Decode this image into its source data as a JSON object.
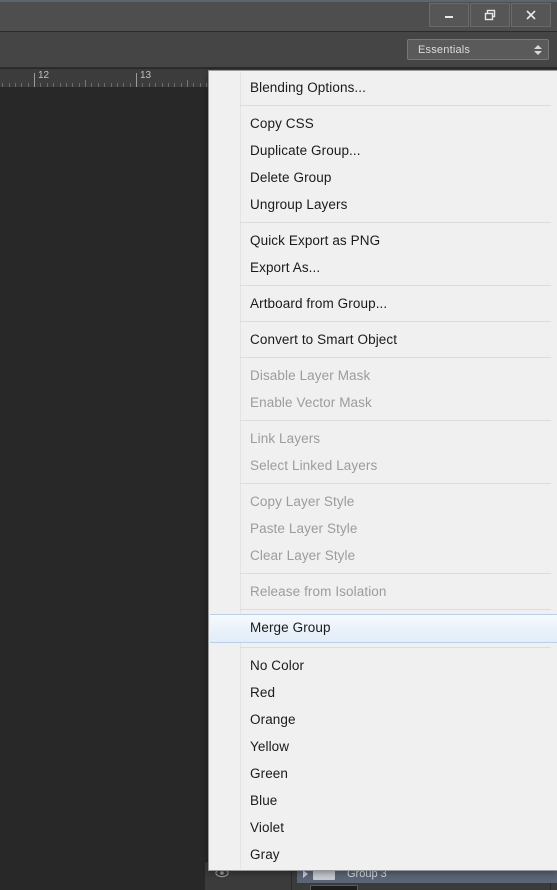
{
  "window": {
    "title_bar_buttons": [
      {
        "name": "minimize",
        "label": "Minimize"
      },
      {
        "name": "restore",
        "label": "Restore Down"
      },
      {
        "name": "close",
        "label": "Close"
      }
    ]
  },
  "options_bar": {
    "workspace_label": "Essentials"
  },
  "ruler": {
    "labels": [
      "12",
      "13"
    ],
    "unit": "in"
  },
  "layers_panel": {
    "rows": [
      {
        "name": "Group 3",
        "selected": true
      }
    ]
  },
  "context_menu": {
    "highlighted_item": "Merge Group",
    "groups": [
      {
        "items": [
          {
            "label": "Blending Options...",
            "disabled": false
          }
        ]
      },
      {
        "items": [
          {
            "label": "Copy CSS",
            "disabled": false
          },
          {
            "label": "Duplicate Group...",
            "disabled": false
          },
          {
            "label": "Delete Group",
            "disabled": false
          },
          {
            "label": "Ungroup Layers",
            "disabled": false
          }
        ]
      },
      {
        "items": [
          {
            "label": "Quick Export as PNG",
            "disabled": false
          },
          {
            "label": "Export As...",
            "disabled": false
          }
        ]
      },
      {
        "items": [
          {
            "label": "Artboard from Group...",
            "disabled": false
          }
        ]
      },
      {
        "items": [
          {
            "label": "Convert to Smart Object",
            "disabled": false
          }
        ]
      },
      {
        "items": [
          {
            "label": "Disable Layer Mask",
            "disabled": true
          },
          {
            "label": "Enable Vector Mask",
            "disabled": true
          }
        ]
      },
      {
        "items": [
          {
            "label": "Link Layers",
            "disabled": true
          },
          {
            "label": "Select Linked Layers",
            "disabled": true
          }
        ]
      },
      {
        "items": [
          {
            "label": "Copy Layer Style",
            "disabled": true
          },
          {
            "label": "Paste Layer Style",
            "disabled": true
          },
          {
            "label": "Clear Layer Style",
            "disabled": true
          }
        ]
      },
      {
        "items": [
          {
            "label": "Release from Isolation",
            "disabled": true
          }
        ]
      },
      {
        "items": [
          {
            "label": "Merge Group",
            "disabled": false,
            "highlighted": true
          }
        ]
      },
      {
        "items": [
          {
            "label": "No Color",
            "disabled": false
          },
          {
            "label": "Red",
            "disabled": false
          },
          {
            "label": "Orange",
            "disabled": false
          },
          {
            "label": "Yellow",
            "disabled": false
          },
          {
            "label": "Green",
            "disabled": false
          },
          {
            "label": "Blue",
            "disabled": false
          },
          {
            "label": "Violet",
            "disabled": false
          },
          {
            "label": "Gray",
            "disabled": false
          }
        ]
      }
    ]
  },
  "colors": {
    "menu_background": "#f0f0f0",
    "menu_text": "#1a1a1a",
    "menu_text_disabled": "#9c9c9c",
    "highlight_background": "#e6f0fa",
    "highlight_border": "#b5d0e8",
    "app_chrome": "#4e4e4e",
    "canvas": "#282828",
    "layer_selected": "#5a6575"
  }
}
